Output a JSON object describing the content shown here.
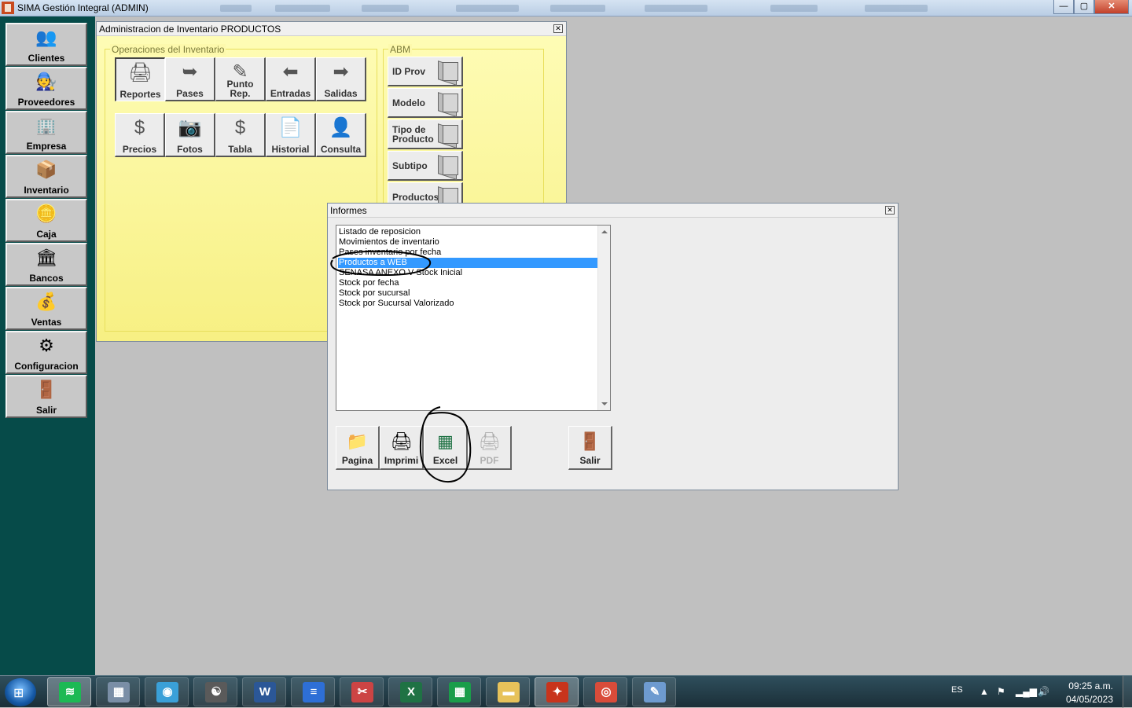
{
  "app": {
    "title": "SIMA Gestión Integral (ADMIN)",
    "window_controls": {
      "minimize": "—",
      "maximize": "▢",
      "close": "✕"
    }
  },
  "sidebar": {
    "items": [
      {
        "label": "Clientes",
        "icon": "clients-icon",
        "glyph": "👥"
      },
      {
        "label": "Proveedores",
        "icon": "suppliers-icon",
        "glyph": "🧑‍🔧"
      },
      {
        "label": "Empresa",
        "icon": "company-icon",
        "glyph": "🏢"
      },
      {
        "label": "Inventario",
        "icon": "inventory-icon",
        "glyph": "📦"
      },
      {
        "label": "Caja",
        "icon": "safe-icon",
        "glyph": "🪙"
      },
      {
        "label": "Bancos",
        "icon": "bank-icon",
        "glyph": "🏛"
      },
      {
        "label": "Ventas",
        "icon": "sales-icon",
        "glyph": "💰"
      },
      {
        "label": "Configuracion",
        "icon": "settings-icon",
        "glyph": "⚙"
      },
      {
        "label": "Salir",
        "icon": "exit-door-icon",
        "glyph": "🚪"
      }
    ]
  },
  "inventory_window": {
    "title": "Administracion de Inventario PRODUCTOS",
    "close": "✕",
    "ops_group_title": "Operaciones del Inventario",
    "ops_buttons": [
      {
        "label": "Reportes",
        "icon": "printer-icon",
        "glyph": "🖨"
      },
      {
        "label": "Pases",
        "icon": "transfer-icon",
        "glyph": "➥"
      },
      {
        "label": "Punto\nRep.",
        "icon": "reorder-point-icon",
        "glyph": "✎"
      },
      {
        "label": "Entradas",
        "icon": "arrow-left-icon",
        "glyph": "⬅"
      },
      {
        "label": "Salidas",
        "icon": "arrow-right-icon",
        "glyph": "➡"
      },
      {
        "label": "Precios",
        "icon": "dollar-icon",
        "glyph": "$"
      },
      {
        "label": "Fotos",
        "icon": "camera-icon",
        "glyph": "📷"
      },
      {
        "label": "Tabla",
        "icon": "dollar-table-icon",
        "glyph": "$"
      },
      {
        "label": "Historial",
        "icon": "history-icon",
        "glyph": "📄"
      },
      {
        "label": "Consulta",
        "icon": "query-icon",
        "glyph": "👤"
      }
    ],
    "abm_group_title": "ABM",
    "abm_buttons": [
      {
        "label": "ID Prov"
      },
      {
        "label": "Modelo"
      },
      {
        "label": "Tipo de\nProducto"
      },
      {
        "label": "Subtipo"
      },
      {
        "label": "Productos"
      }
    ]
  },
  "informes_window": {
    "title": "Informes",
    "close": "✕",
    "list": [
      "Listado de reposicion",
      "Movimientos de inventario",
      "Pases inventario por fecha",
      "Productos a WEB",
      "SENASA ANEXO V Stock Inicial",
      "Stock por fecha",
      "Stock por sucursal",
      "Stock por Sucursal Valorizado"
    ],
    "selected_index": 3,
    "buttons": [
      {
        "label": "Pagina",
        "icon": "folder-icon",
        "glyph": "📁"
      },
      {
        "label": "Imprimi",
        "icon": "printer-icon",
        "glyph": "🖨"
      },
      {
        "label": "Excel",
        "icon": "excel-icon",
        "glyph": "▦"
      },
      {
        "label": "PDF",
        "icon": "pdf-printer-icon",
        "glyph": "🖨"
      },
      {
        "label": "Salir",
        "icon": "exit-door-icon",
        "glyph": "🚪"
      }
    ]
  },
  "taskbar": {
    "apps": [
      {
        "name": "spotify",
        "glyph": "≋",
        "color": "#1db954"
      },
      {
        "name": "calculator",
        "glyph": "▦",
        "color": "#7a8ea6"
      },
      {
        "name": "browser-shield",
        "glyph": "◉",
        "color": "#3aa0d8"
      },
      {
        "name": "gimp",
        "glyph": "☯",
        "color": "#5a5a5a"
      },
      {
        "name": "word",
        "glyph": "W",
        "color": "#2b5797"
      },
      {
        "name": "docs",
        "glyph": "≡",
        "color": "#2e6fd6"
      },
      {
        "name": "snipping-tool",
        "glyph": "✂",
        "color": "#c44"
      },
      {
        "name": "excel",
        "glyph": "X",
        "color": "#1f7244"
      },
      {
        "name": "sheets",
        "glyph": "▦",
        "color": "#1a9d4a"
      },
      {
        "name": "file-explorer",
        "glyph": "▬",
        "color": "#e7c25a"
      },
      {
        "name": "sima",
        "glyph": "✦",
        "color": "#c8341c"
      },
      {
        "name": "chrome",
        "glyph": "◎",
        "color": "#d94c3a"
      },
      {
        "name": "paint",
        "glyph": "✎",
        "color": "#6e9bd0"
      }
    ],
    "language": "ES",
    "time": "09:25 a.m.",
    "date": "04/05/2023"
  }
}
